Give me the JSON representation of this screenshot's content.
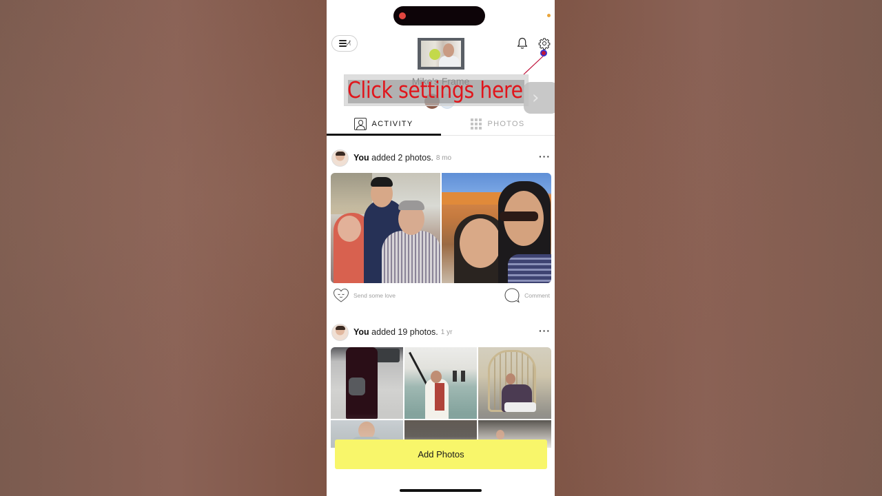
{
  "app": {
    "frame_name": "Mike's Frame",
    "accent_color": "#f8f66a"
  },
  "status_bar": {
    "recording_indicator_color": "#e0463f",
    "privacy_dot_color": "#e9a43a"
  },
  "header": {
    "menu_icon": "hamburger-menu-icon",
    "logo_icon": "aura-logo-icon",
    "notifications_icon": "bell-icon",
    "settings_icon": "gear-icon"
  },
  "annotation": {
    "text": "Click settings here",
    "color": "#e0151b",
    "next_glyph": "›"
  },
  "tabs": [
    {
      "label": "ACTIVITY",
      "icon": "person-icon",
      "active": true
    },
    {
      "label": "PHOTOS",
      "icon": "grid-icon",
      "active": false
    }
  ],
  "feed": [
    {
      "actor": "You",
      "action": "added 2 photos.",
      "time": "8 mo",
      "photo_count": 2,
      "photos": [
        {
          "desc": "Family of three smiling indoors"
        },
        {
          "desc": "Two people selfie in front of temple"
        }
      ],
      "love_label": "Send some love",
      "comment_label": "Comment"
    },
    {
      "actor": "You",
      "action": "added 19 photos.",
      "time": "1 yr",
      "photo_count": 19,
      "photos": [
        {
          "desc": "Person with bag in parking lot"
        },
        {
          "desc": "Woman on glass staircase"
        },
        {
          "desc": "Woman in hanging rattan chair"
        },
        {
          "desc": "Woman outdoors"
        },
        {
          "desc": "Wooden pavilion"
        },
        {
          "desc": "Person under pergola"
        }
      ]
    }
  ],
  "primary_action": {
    "label": "Add Photos"
  }
}
